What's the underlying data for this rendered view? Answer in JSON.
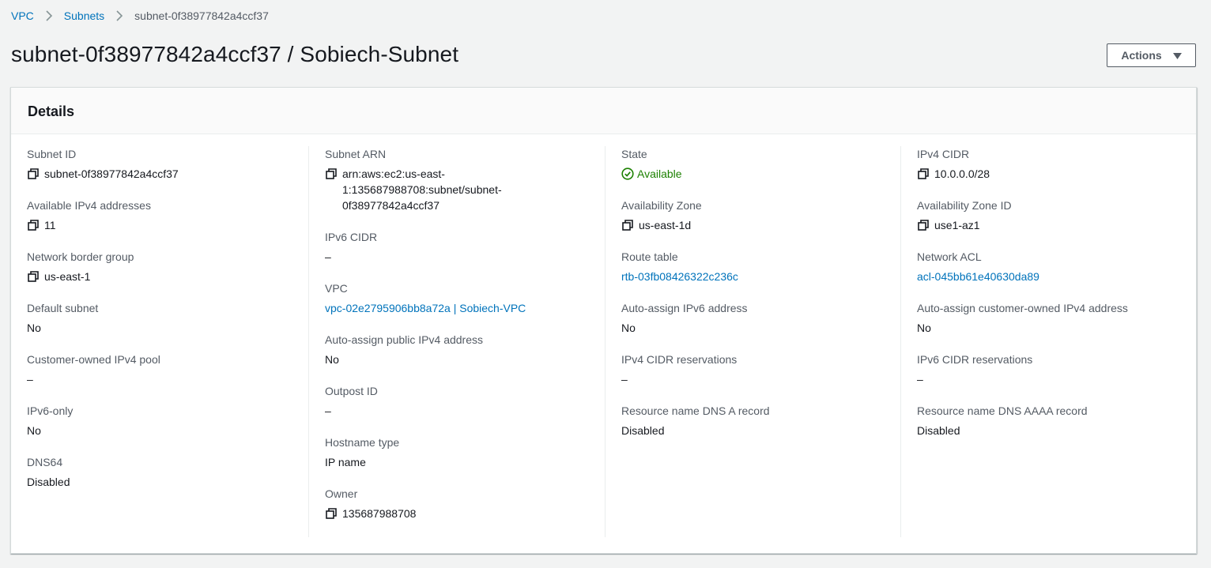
{
  "breadcrumb": {
    "items": [
      {
        "label": "VPC"
      },
      {
        "label": "Subnets"
      },
      {
        "label": "subnet-0f38977842a4ccf37"
      }
    ]
  },
  "header": {
    "title": "subnet-0f38977842a4ccf37 / Sobiech-Subnet",
    "actions_label": "Actions"
  },
  "details": {
    "title": "Details",
    "col1": [
      {
        "label": "Subnet ID",
        "value": "subnet-0f38977842a4ccf37",
        "copy": true
      },
      {
        "label": "Available IPv4 addresses",
        "value": "11",
        "copy": true
      },
      {
        "label": "Network border group",
        "value": "us-east-1",
        "copy": true
      },
      {
        "label": "Default subnet",
        "value": "No"
      },
      {
        "label": "Customer-owned IPv4 pool",
        "value": "–"
      },
      {
        "label": "IPv6-only",
        "value": "No"
      },
      {
        "label": "DNS64",
        "value": "Disabled"
      }
    ],
    "col2": [
      {
        "label": "Subnet ARN",
        "value_lines": [
          "arn:aws:ec2:us-east-",
          "1:135687988708:subnet/subnet-",
          "0f38977842a4ccf37"
        ],
        "copy": true
      },
      {
        "label": "IPv6 CIDR",
        "value": "–"
      },
      {
        "label": "VPC",
        "value": "vpc-02e2795906bb8a72a | Sobiech-VPC",
        "link": true
      },
      {
        "label": "Auto-assign public IPv4 address",
        "value": "No"
      },
      {
        "label": "Outpost ID",
        "value": "–"
      },
      {
        "label": "Hostname type",
        "value": "IP name"
      },
      {
        "label": "Owner",
        "value": "135687988708",
        "copy": true
      }
    ],
    "col3": [
      {
        "label": "State",
        "value": "Available",
        "status": "success"
      },
      {
        "label": "Availability Zone",
        "value": "us-east-1d",
        "copy": true
      },
      {
        "label": "Route table",
        "value": "rtb-03fb08426322c236c",
        "link": true
      },
      {
        "label": "Auto-assign IPv6 address",
        "value": "No"
      },
      {
        "label": "IPv4 CIDR reservations",
        "value": "–"
      },
      {
        "label": "Resource name DNS A record",
        "value": "Disabled"
      }
    ],
    "col4": [
      {
        "label": "IPv4 CIDR",
        "value": "10.0.0.0/28",
        "copy": true
      },
      {
        "label": "Availability Zone ID",
        "value": "use1-az1",
        "copy": true
      },
      {
        "label": "Network ACL",
        "value": "acl-045bb61e40630da89",
        "link": true
      },
      {
        "label": "Auto-assign customer-owned IPv4 address",
        "value": "No"
      },
      {
        "label": "IPv6 CIDR reservations",
        "value": "–"
      },
      {
        "label": "Resource name DNS AAAA record",
        "value": "Disabled"
      }
    ]
  },
  "colors": {
    "link": "#0073bb",
    "success": "#1d8102",
    "background": "#f2f3f3"
  }
}
